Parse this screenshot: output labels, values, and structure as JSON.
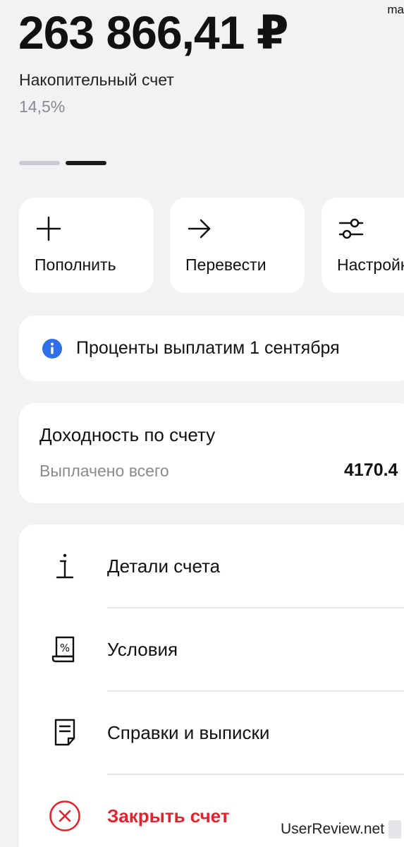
{
  "corner_text": "ma",
  "balance": "263 866,41 ₽",
  "account": {
    "name": "Накопительный счет",
    "rate": "14,5%"
  },
  "pager": {
    "total": 2,
    "active": 2
  },
  "actions": [
    {
      "label": "Пополнить",
      "icon": "plus-icon"
    },
    {
      "label": "Перевести",
      "icon": "arrow-right-icon"
    },
    {
      "label": "Настройки",
      "icon": "sliders-icon"
    }
  ],
  "info": {
    "icon": "info-icon",
    "text": "Проценты выплатим 1 сентября",
    "accent": "#2f6fe8"
  },
  "yield": {
    "title": "Доходность по счету",
    "label": "Выплачено всего",
    "value": "4170.4"
  },
  "menu": [
    {
      "label": "Детали счета",
      "icon": "info-i-icon"
    },
    {
      "label": "Условия",
      "icon": "percent-document-icon"
    },
    {
      "label": "Справки и выписки",
      "icon": "document-icon"
    },
    {
      "label": "Закрыть счет",
      "icon": "close-circle-icon",
      "color": "#e0242e"
    }
  ],
  "watermark": "UserReview.net"
}
